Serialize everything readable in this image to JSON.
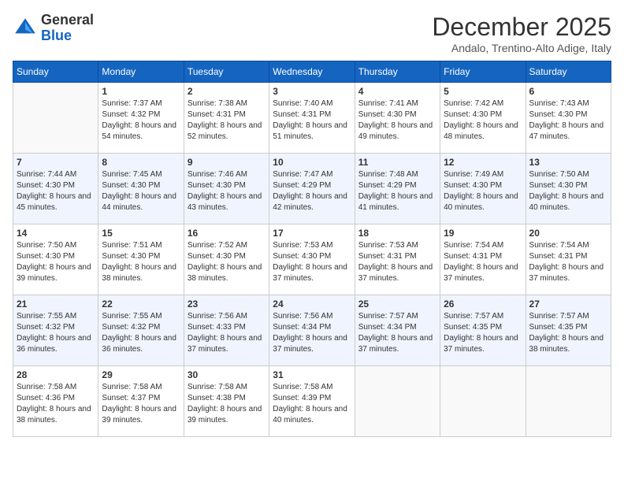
{
  "header": {
    "logo": {
      "general": "General",
      "blue": "Blue"
    },
    "title": "December 2025",
    "location": "Andalo, Trentino-Alto Adige, Italy"
  },
  "weekdays": [
    "Sunday",
    "Monday",
    "Tuesday",
    "Wednesday",
    "Thursday",
    "Friday",
    "Saturday"
  ],
  "weeks": [
    [
      {
        "day": "",
        "sunrise": "",
        "sunset": "",
        "daylight": ""
      },
      {
        "day": "1",
        "sunrise": "Sunrise: 7:37 AM",
        "sunset": "Sunset: 4:32 PM",
        "daylight": "Daylight: 8 hours and 54 minutes."
      },
      {
        "day": "2",
        "sunrise": "Sunrise: 7:38 AM",
        "sunset": "Sunset: 4:31 PM",
        "daylight": "Daylight: 8 hours and 52 minutes."
      },
      {
        "day": "3",
        "sunrise": "Sunrise: 7:40 AM",
        "sunset": "Sunset: 4:31 PM",
        "daylight": "Daylight: 8 hours and 51 minutes."
      },
      {
        "day": "4",
        "sunrise": "Sunrise: 7:41 AM",
        "sunset": "Sunset: 4:30 PM",
        "daylight": "Daylight: 8 hours and 49 minutes."
      },
      {
        "day": "5",
        "sunrise": "Sunrise: 7:42 AM",
        "sunset": "Sunset: 4:30 PM",
        "daylight": "Daylight: 8 hours and 48 minutes."
      },
      {
        "day": "6",
        "sunrise": "Sunrise: 7:43 AM",
        "sunset": "Sunset: 4:30 PM",
        "daylight": "Daylight: 8 hours and 47 minutes."
      }
    ],
    [
      {
        "day": "7",
        "sunrise": "Sunrise: 7:44 AM",
        "sunset": "Sunset: 4:30 PM",
        "daylight": "Daylight: 8 hours and 45 minutes."
      },
      {
        "day": "8",
        "sunrise": "Sunrise: 7:45 AM",
        "sunset": "Sunset: 4:30 PM",
        "daylight": "Daylight: 8 hours and 44 minutes."
      },
      {
        "day": "9",
        "sunrise": "Sunrise: 7:46 AM",
        "sunset": "Sunset: 4:30 PM",
        "daylight": "Daylight: 8 hours and 43 minutes."
      },
      {
        "day": "10",
        "sunrise": "Sunrise: 7:47 AM",
        "sunset": "Sunset: 4:29 PM",
        "daylight": "Daylight: 8 hours and 42 minutes."
      },
      {
        "day": "11",
        "sunrise": "Sunrise: 7:48 AM",
        "sunset": "Sunset: 4:29 PM",
        "daylight": "Daylight: 8 hours and 41 minutes."
      },
      {
        "day": "12",
        "sunrise": "Sunrise: 7:49 AM",
        "sunset": "Sunset: 4:30 PM",
        "daylight": "Daylight: 8 hours and 40 minutes."
      },
      {
        "day": "13",
        "sunrise": "Sunrise: 7:50 AM",
        "sunset": "Sunset: 4:30 PM",
        "daylight": "Daylight: 8 hours and 40 minutes."
      }
    ],
    [
      {
        "day": "14",
        "sunrise": "Sunrise: 7:50 AM",
        "sunset": "Sunset: 4:30 PM",
        "daylight": "Daylight: 8 hours and 39 minutes."
      },
      {
        "day": "15",
        "sunrise": "Sunrise: 7:51 AM",
        "sunset": "Sunset: 4:30 PM",
        "daylight": "Daylight: 8 hours and 38 minutes."
      },
      {
        "day": "16",
        "sunrise": "Sunrise: 7:52 AM",
        "sunset": "Sunset: 4:30 PM",
        "daylight": "Daylight: 8 hours and 38 minutes."
      },
      {
        "day": "17",
        "sunrise": "Sunrise: 7:53 AM",
        "sunset": "Sunset: 4:30 PM",
        "daylight": "Daylight: 8 hours and 37 minutes."
      },
      {
        "day": "18",
        "sunrise": "Sunrise: 7:53 AM",
        "sunset": "Sunset: 4:31 PM",
        "daylight": "Daylight: 8 hours and 37 minutes."
      },
      {
        "day": "19",
        "sunrise": "Sunrise: 7:54 AM",
        "sunset": "Sunset: 4:31 PM",
        "daylight": "Daylight: 8 hours and 37 minutes."
      },
      {
        "day": "20",
        "sunrise": "Sunrise: 7:54 AM",
        "sunset": "Sunset: 4:31 PM",
        "daylight": "Daylight: 8 hours and 37 minutes."
      }
    ],
    [
      {
        "day": "21",
        "sunrise": "Sunrise: 7:55 AM",
        "sunset": "Sunset: 4:32 PM",
        "daylight": "Daylight: 8 hours and 36 minutes."
      },
      {
        "day": "22",
        "sunrise": "Sunrise: 7:55 AM",
        "sunset": "Sunset: 4:32 PM",
        "daylight": "Daylight: 8 hours and 36 minutes."
      },
      {
        "day": "23",
        "sunrise": "Sunrise: 7:56 AM",
        "sunset": "Sunset: 4:33 PM",
        "daylight": "Daylight: 8 hours and 37 minutes."
      },
      {
        "day": "24",
        "sunrise": "Sunrise: 7:56 AM",
        "sunset": "Sunset: 4:34 PM",
        "daylight": "Daylight: 8 hours and 37 minutes."
      },
      {
        "day": "25",
        "sunrise": "Sunrise: 7:57 AM",
        "sunset": "Sunset: 4:34 PM",
        "daylight": "Daylight: 8 hours and 37 minutes."
      },
      {
        "day": "26",
        "sunrise": "Sunrise: 7:57 AM",
        "sunset": "Sunset: 4:35 PM",
        "daylight": "Daylight: 8 hours and 37 minutes."
      },
      {
        "day": "27",
        "sunrise": "Sunrise: 7:57 AM",
        "sunset": "Sunset: 4:35 PM",
        "daylight": "Daylight: 8 hours and 38 minutes."
      }
    ],
    [
      {
        "day": "28",
        "sunrise": "Sunrise: 7:58 AM",
        "sunset": "Sunset: 4:36 PM",
        "daylight": "Daylight: 8 hours and 38 minutes."
      },
      {
        "day": "29",
        "sunrise": "Sunrise: 7:58 AM",
        "sunset": "Sunset: 4:37 PM",
        "daylight": "Daylight: 8 hours and 39 minutes."
      },
      {
        "day": "30",
        "sunrise": "Sunrise: 7:58 AM",
        "sunset": "Sunset: 4:38 PM",
        "daylight": "Daylight: 8 hours and 39 minutes."
      },
      {
        "day": "31",
        "sunrise": "Sunrise: 7:58 AM",
        "sunset": "Sunset: 4:39 PM",
        "daylight": "Daylight: 8 hours and 40 minutes."
      },
      {
        "day": "",
        "sunrise": "",
        "sunset": "",
        "daylight": ""
      },
      {
        "day": "",
        "sunrise": "",
        "sunset": "",
        "daylight": ""
      },
      {
        "day": "",
        "sunrise": "",
        "sunset": "",
        "daylight": ""
      }
    ]
  ]
}
